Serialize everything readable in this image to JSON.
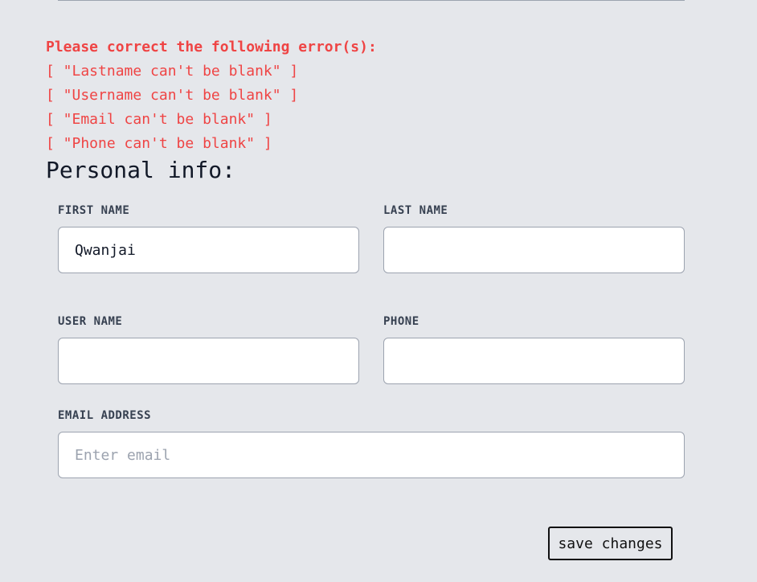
{
  "errors": {
    "heading": "Please correct the following error(s):",
    "items": [
      "[ \"Lastname can't be blank\" ]",
      "[ \"Username can't be blank\" ]",
      "[ \"Email can't be blank\" ]",
      "[ \"Phone can't be blank\" ]"
    ]
  },
  "section": {
    "title": "Personal info:"
  },
  "form": {
    "first_name": {
      "label": "FIRST NAME",
      "value": "Qwanjai",
      "placeholder": ""
    },
    "last_name": {
      "label": "LAST NAME",
      "value": "",
      "placeholder": ""
    },
    "user_name": {
      "label": "USER NAME",
      "value": "",
      "placeholder": ""
    },
    "phone": {
      "label": "PHONE",
      "value": "",
      "placeholder": ""
    },
    "email": {
      "label": "EMAIL ADDRESS",
      "value": "",
      "placeholder": "Enter email"
    },
    "save_label": "save changes"
  },
  "colors": {
    "background": "#e5e7eb",
    "error": "#ef4444",
    "input_border": "#9ca3af"
  }
}
